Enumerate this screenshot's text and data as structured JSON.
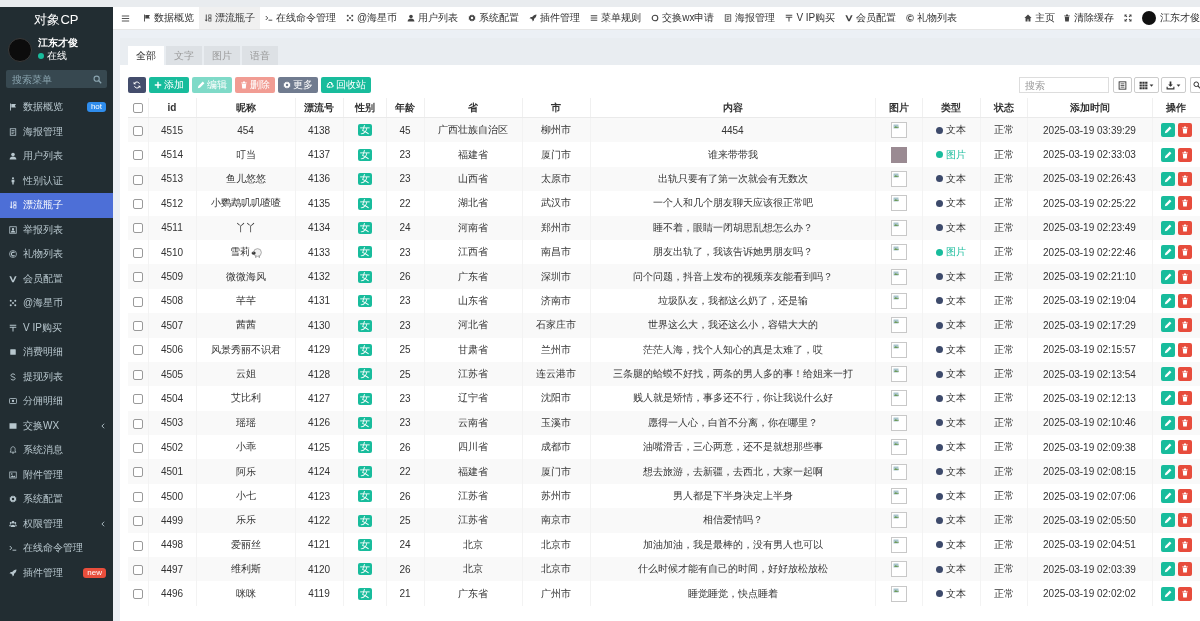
{
  "sidebar": {
    "title": "对象CP",
    "user": {
      "name": "江东才俊",
      "status": "在线"
    },
    "search": {
      "placeholder": "搜索菜单"
    },
    "items": [
      {
        "label": "数据概览",
        "selected": false,
        "caret": false,
        "badge": {
          "text": "hot",
          "color": "#2f8ded"
        }
      },
      {
        "label": "海报管理",
        "selected": false,
        "caret": false
      },
      {
        "label": "用户列表",
        "selected": false,
        "caret": false
      },
      {
        "label": "性别认证",
        "selected": false,
        "caret": false
      },
      {
        "label": "漂流瓶子",
        "selected": true,
        "caret": false
      },
      {
        "label": "举报列表",
        "selected": false,
        "caret": false
      },
      {
        "label": "礼物列表",
        "selected": false,
        "caret": false
      },
      {
        "label": "会员配置",
        "selected": false,
        "caret": false
      },
      {
        "label": "@海星币",
        "selected": false,
        "caret": false
      },
      {
        "label": "V IP购买",
        "selected": false,
        "caret": false
      },
      {
        "label": "消费明细",
        "selected": false,
        "caret": false
      },
      {
        "label": "提现列表",
        "selected": false,
        "caret": false
      },
      {
        "label": "分佣明细",
        "selected": false,
        "caret": false
      },
      {
        "label": "交换WX",
        "selected": false,
        "caret": true
      },
      {
        "label": "系统消息",
        "selected": false,
        "caret": false
      },
      {
        "label": "附件管理",
        "selected": false,
        "caret": false
      },
      {
        "label": "系统配置",
        "selected": false,
        "caret": false
      },
      {
        "label": "权限管理",
        "selected": false,
        "caret": true
      },
      {
        "label": "在线命令管理",
        "selected": false,
        "caret": false
      },
      {
        "label": "插件管理",
        "selected": false,
        "caret": false,
        "badge": {
          "text": "new",
          "color": "#e94e3c"
        }
      }
    ]
  },
  "topbar": {
    "tabs": [
      {
        "label": "数据概览",
        "selected": false
      },
      {
        "label": "漂流瓶子",
        "selected": true
      },
      {
        "label": "在线命令管理",
        "selected": false
      },
      {
        "label": "@海星币",
        "selected": false
      },
      {
        "label": "用户列表",
        "selected": false
      },
      {
        "label": "系统配置",
        "selected": false
      },
      {
        "label": "插件管理",
        "selected": false
      },
      {
        "label": "菜单规则",
        "selected": false
      },
      {
        "label": "交换wx申请",
        "selected": false
      },
      {
        "label": "海报管理",
        "selected": false
      },
      {
        "label": "V IP购买",
        "selected": false
      },
      {
        "label": "会员配置",
        "selected": false
      },
      {
        "label": "礼物列表",
        "selected": false
      }
    ],
    "links": [
      {
        "label": "主页"
      },
      {
        "label": "清除缓存"
      }
    ],
    "user": {
      "name": "江东才俊"
    }
  },
  "panel": {
    "tabs": [
      {
        "label": "全部",
        "selected": true
      },
      {
        "label": "文字",
        "selected": false
      },
      {
        "label": "图片",
        "selected": false
      },
      {
        "label": "语音",
        "selected": false
      }
    ],
    "toolbar": {
      "buttons": [
        {
          "kind": "refresh",
          "disabled": false
        },
        {
          "kind": "add",
          "label": "添加",
          "disabled": false
        },
        {
          "kind": "edit",
          "label": "编辑",
          "disabled": true
        },
        {
          "kind": "delete",
          "label": "删除",
          "disabled": true
        },
        {
          "kind": "more",
          "label": "更多",
          "disabled": false
        },
        {
          "kind": "recycle",
          "label": "回收站",
          "disabled": false
        }
      ],
      "search": {
        "placeholder": "搜索"
      }
    }
  },
  "table": {
    "all_checked": false,
    "columns": [
      "id",
      "昵称",
      "漂流号",
      "性别",
      "年龄",
      "省",
      "市",
      "内容",
      "图片",
      "类型",
      "状态",
      "添加时间",
      "操作"
    ],
    "rows": [
      {
        "selected": false,
        "id": "4515",
        "nickname": "454",
        "emoji": false,
        "number": "4138",
        "gender": "女",
        "age": "45",
        "province": "广西壮族自治区",
        "city": "柳州市",
        "content": "4454",
        "photo": false,
        "type": {
          "kind": "text",
          "label": "文本",
          "color": "#3d4a6b"
        },
        "status": "正常",
        "time": "2025-03-19 03:39:29"
      },
      {
        "selected": false,
        "id": "4514",
        "nickname": "叮当",
        "emoji": false,
        "number": "4137",
        "gender": "女",
        "age": "23",
        "province": "福建省",
        "city": "厦门市",
        "content": "谁来带带我",
        "photo": true,
        "type": {
          "kind": "image",
          "label": "图片",
          "color": "#18bc9c"
        },
        "status": "正常",
        "time": "2025-03-19 02:33:03"
      },
      {
        "selected": false,
        "id": "4513",
        "nickname": "鱼儿悠悠",
        "emoji": false,
        "number": "4136",
        "gender": "女",
        "age": "23",
        "province": "山西省",
        "city": "太原市",
        "content": "出轨只要有了第一次就会有无数次",
        "photo": false,
        "type": {
          "kind": "text",
          "label": "文本",
          "color": "#3d4a6b"
        },
        "status": "正常",
        "time": "2025-03-19 02:26:43"
      },
      {
        "selected": false,
        "id": "4512",
        "nickname": "小鹦鹉叽叽喳喳",
        "emoji": false,
        "number": "4135",
        "gender": "女",
        "age": "22",
        "province": "湖北省",
        "city": "武汉市",
        "content": "一个人和几个朋友聊天应该很正常吧",
        "photo": false,
        "type": {
          "kind": "text",
          "label": "文本",
          "color": "#3d4a6b"
        },
        "status": "正常",
        "time": "2025-03-19 02:25:22"
      },
      {
        "selected": false,
        "id": "4511",
        "nickname": "丫丫",
        "emoji": false,
        "number": "4134",
        "gender": "女",
        "age": "24",
        "province": "河南省",
        "city": "郑州市",
        "content": "睡不着，眼睛一闭胡思乱想怎么办？",
        "photo": false,
        "type": {
          "kind": "text",
          "label": "文本",
          "color": "#3d4a6b"
        },
        "status": "正常",
        "time": "2025-03-19 02:23:49"
      },
      {
        "selected": false,
        "id": "4510",
        "nickname": "雪莉",
        "emoji": true,
        "number": "4133",
        "gender": "女",
        "age": "23",
        "province": "江西省",
        "city": "南昌市",
        "content": "朋友出轨了，我该告诉她男朋友吗？",
        "photo": false,
        "type": {
          "kind": "image",
          "label": "图片",
          "color": "#18bc9c"
        },
        "status": "正常",
        "time": "2025-03-19 02:22:46"
      },
      {
        "selected": false,
        "id": "4509",
        "nickname": "微微海风",
        "emoji": false,
        "number": "4132",
        "gender": "女",
        "age": "26",
        "province": "广东省",
        "city": "深圳市",
        "content": "问个问题，抖音上发布的视频亲友能看到吗？",
        "photo": false,
        "type": {
          "kind": "text",
          "label": "文本",
          "color": "#3d4a6b"
        },
        "status": "正常",
        "time": "2025-03-19 02:21:10"
      },
      {
        "selected": false,
        "id": "4508",
        "nickname": "芊芊",
        "emoji": false,
        "number": "4131",
        "gender": "女",
        "age": "23",
        "province": "山东省",
        "city": "济南市",
        "content": "垃圾队友，我都这么奶了，还是输",
        "photo": false,
        "type": {
          "kind": "text",
          "label": "文本",
          "color": "#3d4a6b"
        },
        "status": "正常",
        "time": "2025-03-19 02:19:04"
      },
      {
        "selected": false,
        "id": "4507",
        "nickname": "茜茜",
        "emoji": false,
        "number": "4130",
        "gender": "女",
        "age": "23",
        "province": "河北省",
        "city": "石家庄市",
        "content": "世界这么大，我还这么小，容错大大的",
        "photo": false,
        "type": {
          "kind": "text",
          "label": "文本",
          "color": "#3d4a6b"
        },
        "status": "正常",
        "time": "2025-03-19 02:17:29"
      },
      {
        "selected": false,
        "id": "4506",
        "nickname": "风景秀丽不识君",
        "emoji": false,
        "number": "4129",
        "gender": "女",
        "age": "25",
        "province": "甘肃省",
        "city": "兰州市",
        "content": "茫茫人海，找个人知心的真是太难了，哎",
        "photo": false,
        "type": {
          "kind": "text",
          "label": "文本",
          "color": "#3d4a6b"
        },
        "status": "正常",
        "time": "2025-03-19 02:15:57"
      },
      {
        "selected": false,
        "id": "4505",
        "nickname": "云姐",
        "emoji": false,
        "number": "4128",
        "gender": "女",
        "age": "25",
        "province": "江苏省",
        "city": "连云港市",
        "content": "三条腿的蛤蟆不好找，两条的男人多的事！给姐来一打",
        "photo": false,
        "type": {
          "kind": "text",
          "label": "文本",
          "color": "#3d4a6b"
        },
        "status": "正常",
        "time": "2025-03-19 02:13:54"
      },
      {
        "selected": false,
        "id": "4504",
        "nickname": "艾比利",
        "emoji": false,
        "number": "4127",
        "gender": "女",
        "age": "23",
        "province": "辽宁省",
        "city": "沈阳市",
        "content": "贱人就是矫情，事多还不行，你让我说什么好",
        "photo": false,
        "type": {
          "kind": "text",
          "label": "文本",
          "color": "#3d4a6b"
        },
        "status": "正常",
        "time": "2025-03-19 02:12:13"
      },
      {
        "selected": false,
        "id": "4503",
        "nickname": "瑶瑶",
        "emoji": false,
        "number": "4126",
        "gender": "女",
        "age": "23",
        "province": "云南省",
        "city": "玉溪市",
        "content": "愿得一人心，白首不分离，你在哪里？",
        "photo": false,
        "type": {
          "kind": "text",
          "label": "文本",
          "color": "#3d4a6b"
        },
        "status": "正常",
        "time": "2025-03-19 02:10:46"
      },
      {
        "selected": false,
        "id": "4502",
        "nickname": "小乖",
        "emoji": false,
        "number": "4125",
        "gender": "女",
        "age": "26",
        "province": "四川省",
        "city": "成都市",
        "content": "油嘴滑舌，三心两意，还不是就想那些事",
        "photo": false,
        "type": {
          "kind": "text",
          "label": "文本",
          "color": "#3d4a6b"
        },
        "status": "正常",
        "time": "2025-03-19 02:09:38"
      },
      {
        "selected": false,
        "id": "4501",
        "nickname": "阿乐",
        "emoji": false,
        "number": "4124",
        "gender": "女",
        "age": "22",
        "province": "福建省",
        "city": "厦门市",
        "content": "想去旅游，去新疆，去西北，大家一起啊",
        "photo": false,
        "type": {
          "kind": "text",
          "label": "文本",
          "color": "#3d4a6b"
        },
        "status": "正常",
        "time": "2025-03-19 02:08:15"
      },
      {
        "selected": false,
        "id": "4500",
        "nickname": "小七",
        "emoji": false,
        "number": "4123",
        "gender": "女",
        "age": "26",
        "province": "江苏省",
        "city": "苏州市",
        "content": "男人都是下半身决定上半身",
        "photo": false,
        "type": {
          "kind": "text",
          "label": "文本",
          "color": "#3d4a6b"
        },
        "status": "正常",
        "time": "2025-03-19 02:07:06"
      },
      {
        "selected": false,
        "id": "4499",
        "nickname": "乐乐",
        "emoji": false,
        "number": "4122",
        "gender": "女",
        "age": "25",
        "province": "江苏省",
        "city": "南京市",
        "content": "相信爱情吗？",
        "photo": false,
        "type": {
          "kind": "text",
          "label": "文本",
          "color": "#3d4a6b"
        },
        "status": "正常",
        "time": "2025-03-19 02:05:50"
      },
      {
        "selected": false,
        "id": "4498",
        "nickname": "爱丽丝",
        "emoji": false,
        "number": "4121",
        "gender": "女",
        "age": "24",
        "province": "北京",
        "city": "北京市",
        "content": "加油加油，我是最棒的，没有男人也可以",
        "photo": false,
        "type": {
          "kind": "text",
          "label": "文本",
          "color": "#3d4a6b"
        },
        "status": "正常",
        "time": "2025-03-19 02:04:51"
      },
      {
        "selected": false,
        "id": "4497",
        "nickname": "维利斯",
        "emoji": false,
        "number": "4120",
        "gender": "女",
        "age": "26",
        "province": "北京",
        "city": "北京市",
        "content": "什么时候才能有自己的时间，好好放松放松",
        "photo": false,
        "type": {
          "kind": "text",
          "label": "文本",
          "color": "#3d4a6b"
        },
        "status": "正常",
        "time": "2025-03-19 02:03:39"
      },
      {
        "selected": false,
        "id": "4496",
        "nickname": "咪咪",
        "emoji": false,
        "number": "4119",
        "gender": "女",
        "age": "21",
        "province": "广东省",
        "city": "广州市",
        "content": "睡觉睡觉，快点睡着",
        "photo": false,
        "type": {
          "kind": "text",
          "label": "文本",
          "color": "#3d4a6b"
        },
        "status": "正常",
        "time": "2025-03-19 02:02:02"
      }
    ]
  }
}
